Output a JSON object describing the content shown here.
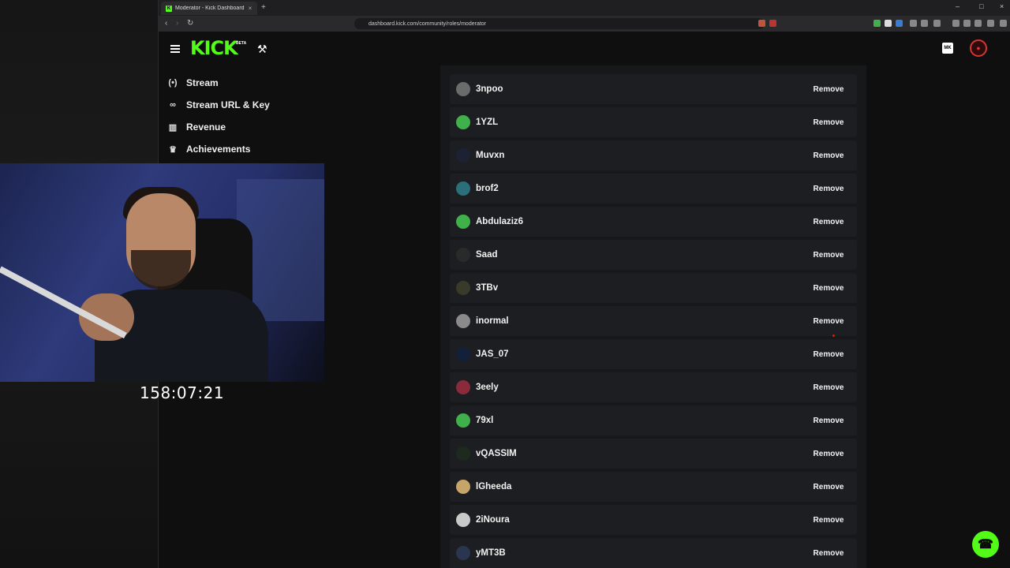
{
  "browser": {
    "tab_title": "Moderator - Kick Dashboard",
    "tab_close": "×",
    "new_tab": "+",
    "url": "dashboard.kick.com/community/roles/moderator",
    "window_controls": [
      "–",
      "□",
      "×"
    ]
  },
  "header": {
    "logo_text": "KICK",
    "logo_badge": "BETA",
    "right_badge": "MK"
  },
  "sidebar": {
    "items": [
      {
        "label": "Stream",
        "icon": "broadcast-icon"
      },
      {
        "label": "Stream URL & Key",
        "icon": "link-icon"
      },
      {
        "label": "Revenue",
        "icon": "chart-icon"
      },
      {
        "label": "Achievements",
        "icon": "trophy-icon"
      }
    ]
  },
  "overlay": {
    "timer": "158:07:21"
  },
  "moderators": {
    "remove_label": "Remove",
    "users": [
      {
        "name": "3npoo",
        "avatar_color": "#6b6b6b"
      },
      {
        "name": "1YZL",
        "avatar_color": "#3fb04a"
      },
      {
        "name": "Muvxn",
        "avatar_color": "#1c2233"
      },
      {
        "name": "brof2",
        "avatar_color": "#2b6f7a"
      },
      {
        "name": "Abdulaziz6",
        "avatar_color": "#3fb04a"
      },
      {
        "name": "Saad",
        "avatar_color": "#2a2a2a"
      },
      {
        "name": "3TBv",
        "avatar_color": "#3a3a2a"
      },
      {
        "name": "inormal",
        "avatar_color": "#8a8a8a"
      },
      {
        "name": "JAS_07",
        "avatar_color": "#12203a"
      },
      {
        "name": "3eely",
        "avatar_color": "#8a2a3a"
      },
      {
        "name": "79xl",
        "avatar_color": "#3fb04a"
      },
      {
        "name": "vQASSIM",
        "avatar_color": "#1d2a1d"
      },
      {
        "name": "lGheeda",
        "avatar_color": "#c7a468"
      },
      {
        "name": "2iNoura",
        "avatar_color": "#c9c9c9"
      },
      {
        "name": "yMT3B",
        "avatar_color": "#2a3550"
      }
    ]
  },
  "colors": {
    "brand": "#53fc18",
    "background": "#0b0b0c",
    "row": "#1d1e21"
  }
}
